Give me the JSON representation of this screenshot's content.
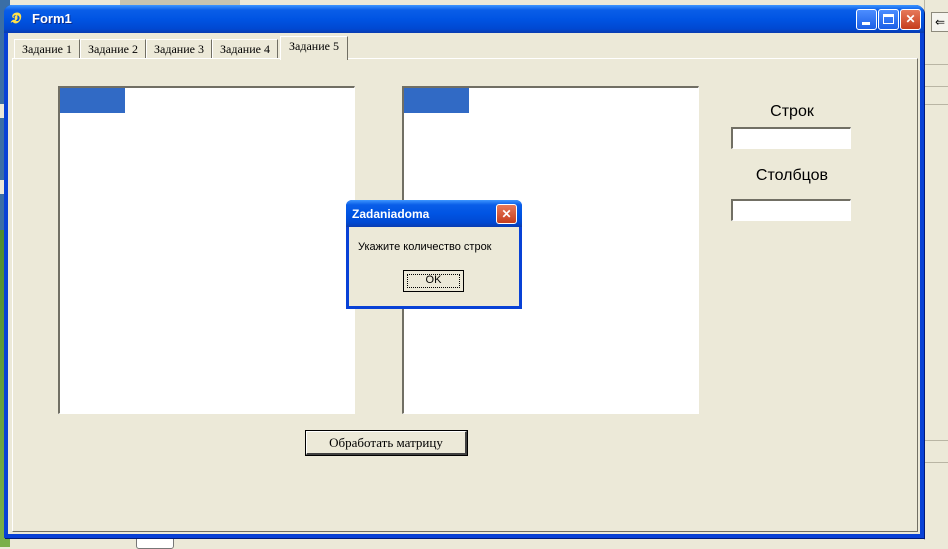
{
  "window": {
    "title": "Form1",
    "icon": "delphi-app-icon",
    "controls": {
      "minimize": "minimize-icon",
      "maximize": "maximize-icon",
      "close": "close-icon"
    }
  },
  "tabs": [
    {
      "label": "Задание 1",
      "active": false
    },
    {
      "label": "Задание 2",
      "active": false
    },
    {
      "label": "Задание 3",
      "active": false
    },
    {
      "label": "Задание 4",
      "active": false
    },
    {
      "label": "Задание 5",
      "active": true
    }
  ],
  "form": {
    "rows_label": "Строк",
    "rows_value": "",
    "cols_label": "Столбцов",
    "cols_value": "",
    "process_button": "Обработать матрицу"
  },
  "dialog": {
    "title": "Zadaniadoma",
    "message": "Укажите количество строк",
    "ok_label": "OK"
  },
  "colors": {
    "titlebar": "#0054e3",
    "face": "#ece9d8",
    "selection": "#316ac5",
    "close_button": "#c63d1d"
  }
}
